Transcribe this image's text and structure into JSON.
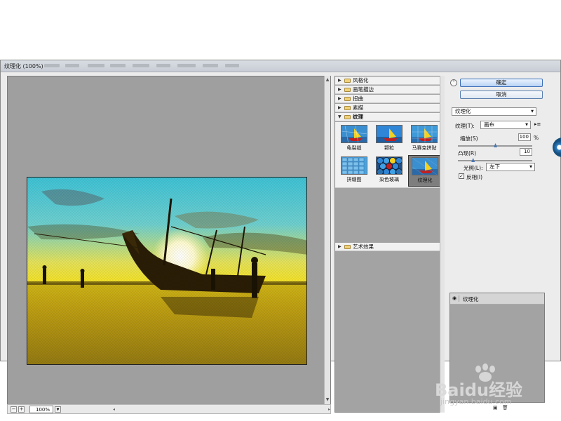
{
  "window": {
    "title": "纹理化 (100%)"
  },
  "preview": {
    "zoom": "100%"
  },
  "gallery": {
    "categories_top": [
      {
        "label": "风格化",
        "open": false
      },
      {
        "label": "画笔描边",
        "open": false
      },
      {
        "label": "扭曲",
        "open": false
      },
      {
        "label": "素描",
        "open": false
      },
      {
        "label": "纹理",
        "open": true
      }
    ],
    "thumbnails": [
      {
        "label": "龟裂缝"
      },
      {
        "label": "颗粒"
      },
      {
        "label": "马赛克拼贴"
      },
      {
        "label": "拼缀图"
      },
      {
        "label": "染色玻璃"
      },
      {
        "label": "纹理化",
        "selected": true
      }
    ],
    "category_bottom": {
      "label": "艺术效果",
      "open": false
    }
  },
  "settings": {
    "ok_label": "确定",
    "cancel_label": "取消",
    "filter_select": "纹理化",
    "texture_label": "纹理(T):",
    "texture_value": "画布",
    "scale_label": "缩放(S)",
    "scale_value": "100",
    "scale_unit": "%",
    "scale_level": 0.5,
    "relief_label": "凸现(R)",
    "relief_value": "10",
    "relief_level": 0.2,
    "light_label": "光照(L):",
    "light_value": "左下",
    "invert_label": "反相(I)",
    "invert_checked": true
  },
  "layers": {
    "items": [
      {
        "label": "纹理化"
      }
    ]
  },
  "watermark": {
    "brand": "Baidu经验",
    "url": "jingyan.baidu.com"
  },
  "colors": {
    "accent": "#3d6fb8",
    "panel": "#ececec",
    "canvas": "#9f9f9f"
  }
}
